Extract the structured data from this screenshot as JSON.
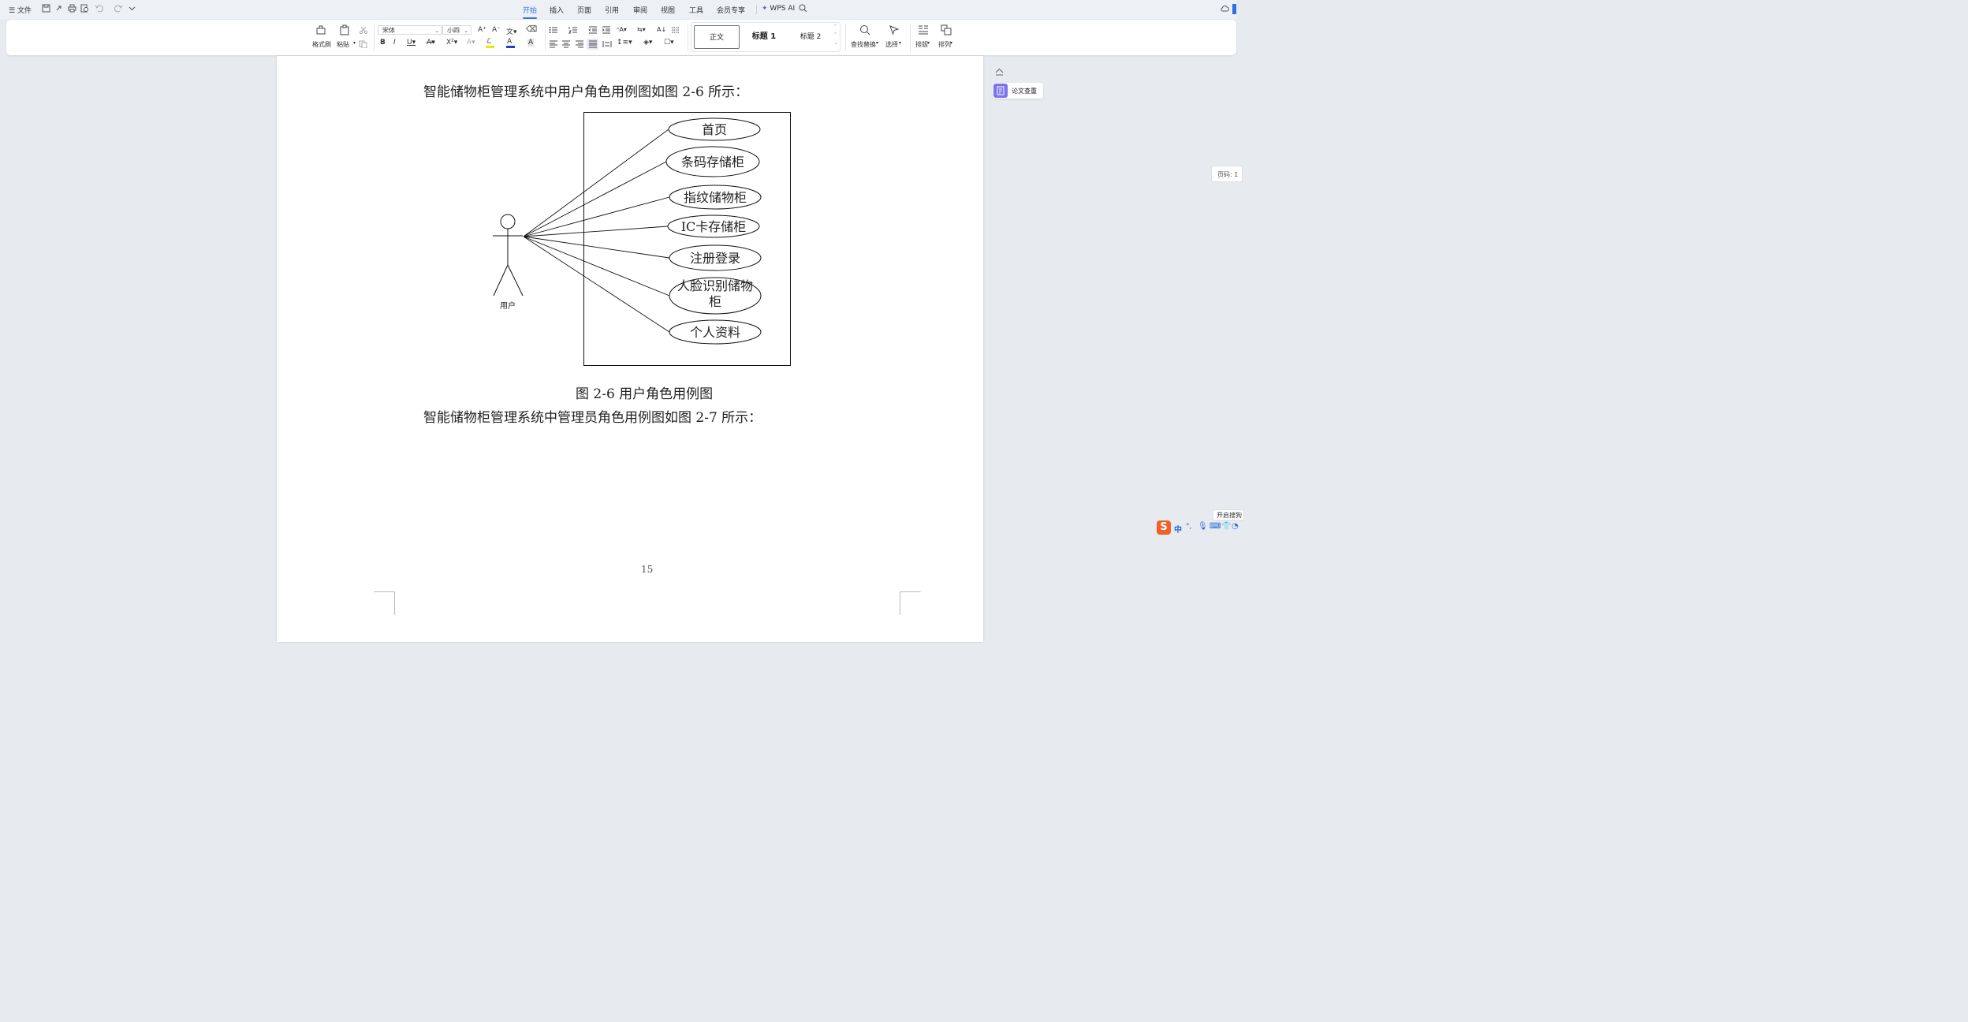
{
  "menu": {
    "file": "文件",
    "tabs": [
      "开始",
      "插入",
      "页面",
      "引用",
      "审阅",
      "视图",
      "工具",
      "会员专享"
    ],
    "active_tab": "开始",
    "wps_ai": "WPS AI"
  },
  "ribbon": {
    "format_painter": "格式刷",
    "paste": "粘贴",
    "font_name": "宋体",
    "font_size": "小四",
    "styles": [
      "正文",
      "标题 1",
      "标题 2"
    ],
    "find_replace": "查找替换",
    "select": "选择",
    "layout": "排版",
    "arrange": "排列"
  },
  "document": {
    "para1": "智能储物柜管理系统中用户角色用例图如图 2-6 所示：",
    "diagram": {
      "actor": "用户",
      "use_cases": [
        "首页",
        "条码存储柜",
        "指纹储物柜",
        "IC卡存储柜",
        "注册登录",
        "人脸识别储物柜",
        "个人资料"
      ]
    },
    "caption": "图 2-6  用户角色用例图",
    "para2": "智能储物柜管理系统中管理员角色用例图如图 2-7 所示：",
    "page_number": "15"
  },
  "side": {
    "plagiarism_check": "论文查重",
    "page_indicator": "页码: 1",
    "ime_tooltip": "开启搜狗"
  },
  "colors": {
    "accent": "#3d6fe0",
    "purple": "#7c74ea",
    "ime_orange": "#f0612a",
    "ime_blue": "#2466d6"
  }
}
